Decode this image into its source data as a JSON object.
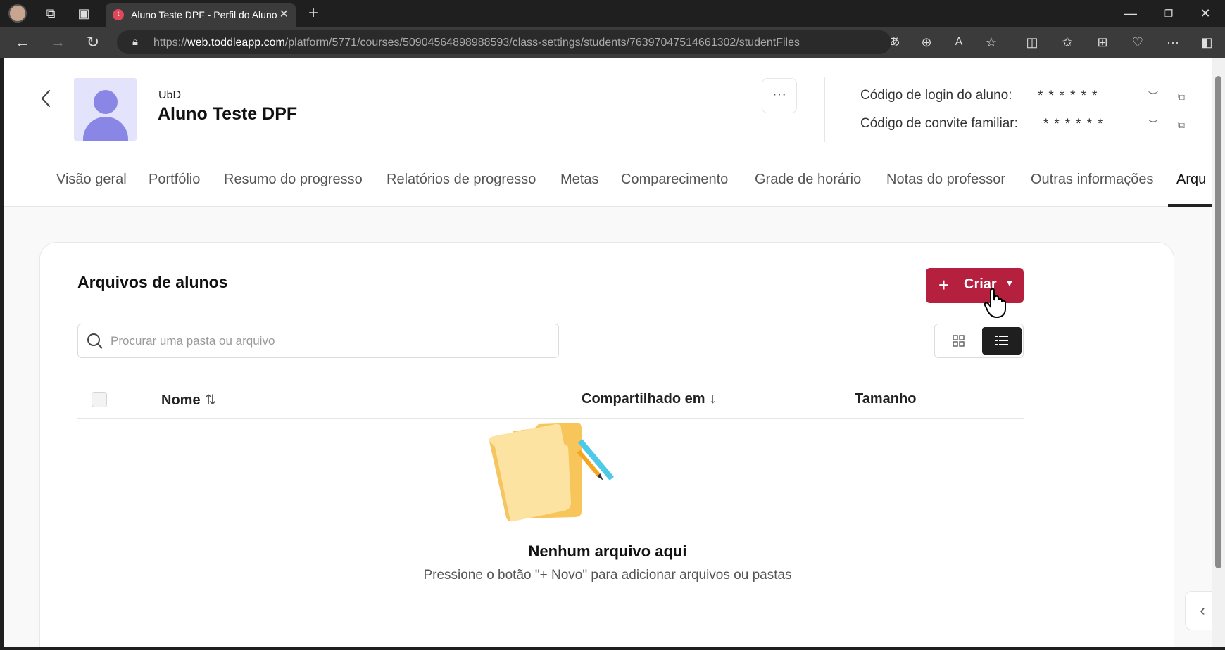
{
  "browser": {
    "tab_title": "Aluno Teste DPF - Perfil do Aluno",
    "favicon_letter": "t",
    "url_prefix": "https://",
    "url_domain": "web.toddleapp.com",
    "url_path": "/platform/5771/courses/50904564898988593/class-settings/students/76397047514661302/studentFiles"
  },
  "student": {
    "group": "UbD",
    "name": "Aluno Teste DPF",
    "more_label": "···",
    "login_code_label": "Código de login do aluno:",
    "login_code_value": "******",
    "family_code_label": "Código de convite familiar:",
    "family_code_value": "******"
  },
  "tabs": [
    {
      "label": "Visão geral"
    },
    {
      "label": "Portfólio"
    },
    {
      "label": "Resumo do progresso"
    },
    {
      "label": "Relatórios de progresso"
    },
    {
      "label": "Metas"
    },
    {
      "label": "Comparecimento"
    },
    {
      "label": "Grade de horário"
    },
    {
      "label": "Notas do professor"
    },
    {
      "label": "Outras informações"
    },
    {
      "label": "Arqu"
    }
  ],
  "files": {
    "title": "Arquivos de alunos",
    "create_label": "Criar",
    "search_placeholder": "Procurar uma pasta ou arquivo",
    "columns": {
      "name": "Nome",
      "shared": "Compartilhado em",
      "size": "Tamanho"
    },
    "empty_title": "Nenhum arquivo aqui",
    "empty_subtitle": "Pressione o botão \"+ Novo\" para adicionar arquivos ou pastas"
  },
  "colors": {
    "accent": "#b5203f",
    "avatar_bg": "#e3e3fb",
    "avatar_fg": "#8a86e6"
  }
}
